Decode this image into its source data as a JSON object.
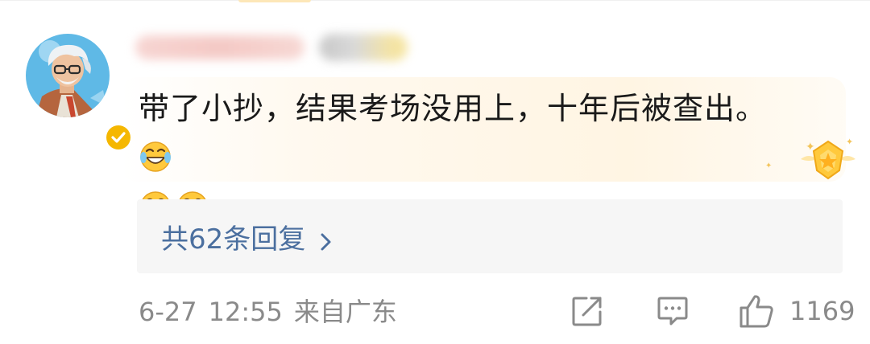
{
  "comment": {
    "text": "带了小抄，结果考场没用上，十年后被查出。",
    "emojis": [
      "laugh-cry-emoji",
      "laugh-cry-emoji",
      "laugh-cry-emoji"
    ]
  },
  "replies": {
    "label": "共62条回复"
  },
  "footer": {
    "date": "6-27",
    "time": "12:55",
    "location": "来自广东",
    "like_count": "1169"
  },
  "icons": {
    "share": "share-icon",
    "comment": "comment-icon",
    "like": "thumbs-up-icon",
    "verified": "verified-badge-icon",
    "chevron": "chevron-right-icon",
    "medal": "medal-icon"
  },
  "colors": {
    "text": "#1a1a1a",
    "muted": "#8a8a8a",
    "link": "#4b6f9f",
    "reply_bg": "#f6f6f6",
    "badge": "#f5b700"
  }
}
